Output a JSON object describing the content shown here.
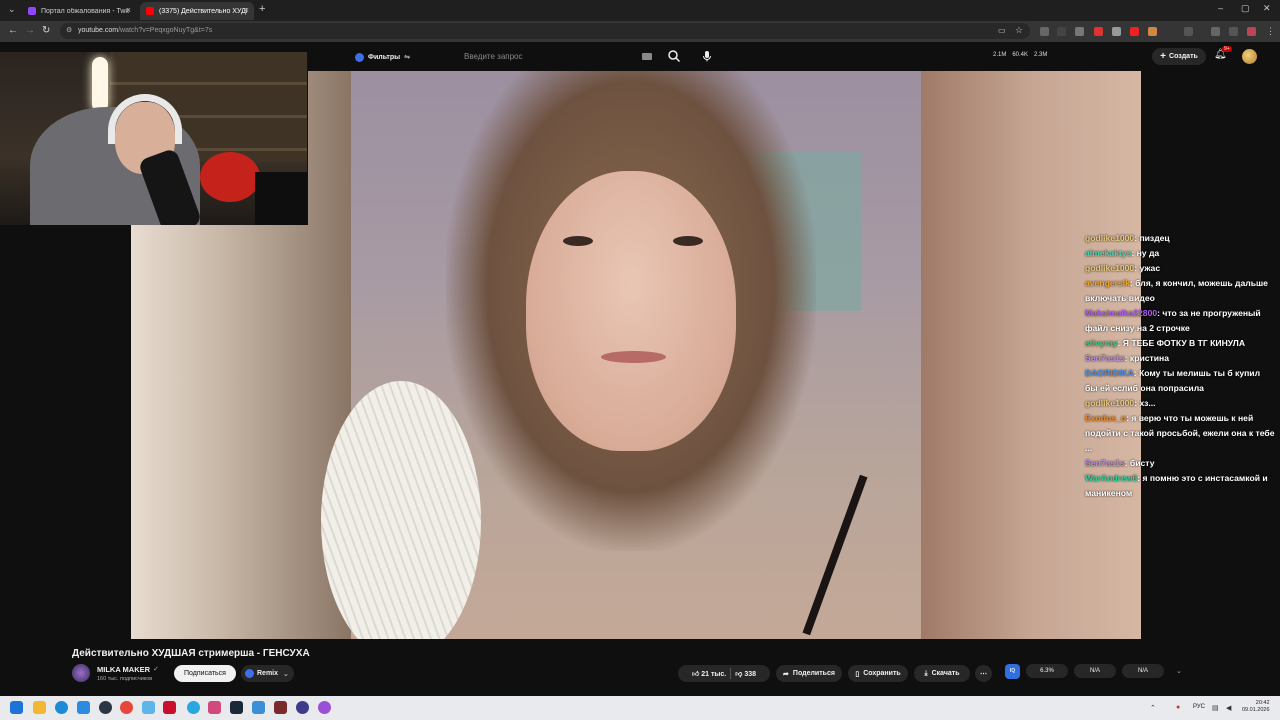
{
  "browser": {
    "tabs": [
      {
        "label": "Портал обжалования - Twitch",
        "favicon_color": "#9146ff",
        "active": false
      },
      {
        "label": "(3375) Действительно ХУДШАЯ ...",
        "favicon_color": "#ff0000",
        "active": true
      }
    ],
    "new_tab": "+",
    "window_controls": {
      "minimize": "–",
      "maximize": "▢",
      "close": "✕"
    },
    "nav": {
      "back": "←",
      "forward": "→",
      "reload": "↻"
    },
    "url": {
      "host": "youtube.com",
      "path": "/watch?v=PeqxgoNuyTg&t=7s"
    }
  },
  "youtube": {
    "filters_label": "Фильтры",
    "search_placeholder": "Введите запрос",
    "stats": [
      "2.1M",
      "60.4K",
      "2.3M"
    ],
    "create_label": "Создать",
    "notif_badge": "9+"
  },
  "chat": [
    {
      "user": "godlike1000",
      "color": "#e8c97a",
      "text": "пиздец"
    },
    {
      "user": "almekaktys",
      "color": "#4fd6b3",
      "text": "ну да"
    },
    {
      "user": "godlike1000",
      "color": "#e8c97a",
      "text": "ужас"
    },
    {
      "user": "avengersik",
      "color": "#f5a623",
      "text": "бля, я кончил, можешь дальше включать видео"
    },
    {
      "user": "Maksimalka22800",
      "color": "#b15cf0",
      "text": "что за не прогруженый файл снизу на 2 строчке"
    },
    {
      "user": "stivyray",
      "color": "#3fc77a",
      "text": "Я ТЕБЕ ФОТКУ В ТГ КИНУЛА"
    },
    {
      "user": "Sen7as1s",
      "color": "#b58be0",
      "text": "кристина"
    },
    {
      "user": "DAORIDIKA",
      "color": "#4a90e2",
      "text": "Кому ты мелишь ты б купил бы ей еслиб она попрасила"
    },
    {
      "user": "godlike1000",
      "color": "#e8c97a",
      "text": "хз..."
    },
    {
      "user": "Exodus_o",
      "color": "#f08a24",
      "text": "я верю что ты можешь к ней подойти с такой просьбой, ежели она к тебе ..."
    },
    {
      "user": "Sen7as1s",
      "color": "#b58be0",
      "text": "бисту"
    },
    {
      "user": "WarAndrew6",
      "color": "#2fd49a",
      "text": "я помню это с инстасамкой и маникеном"
    }
  ],
  "video": {
    "title": "Действительно ХУДШАЯ стримерша - ГЕНСУХА",
    "channel": "MILKA MAKER",
    "subscribers": "160 тыс. подписчиков",
    "subscribe_label": "Подписаться",
    "remix_label": "Remix",
    "likes": "21 тыс.",
    "dislikes": "338",
    "share_label": "Поделиться",
    "save_label": "Сохранить",
    "download_label": "Скачать",
    "more_label": "⋯"
  },
  "extension": {
    "logo_text": "IQ",
    "cells": [
      "6.3%",
      "N/A",
      "N/A"
    ]
  },
  "taskbar": {
    "lang": "РУС",
    "time": "20:42",
    "date": "09.01.2026"
  },
  "colors": {
    "accent_blue": "#3e6ee8",
    "youtube_red": "#ff0000",
    "twitch_purple": "#9146ff"
  }
}
